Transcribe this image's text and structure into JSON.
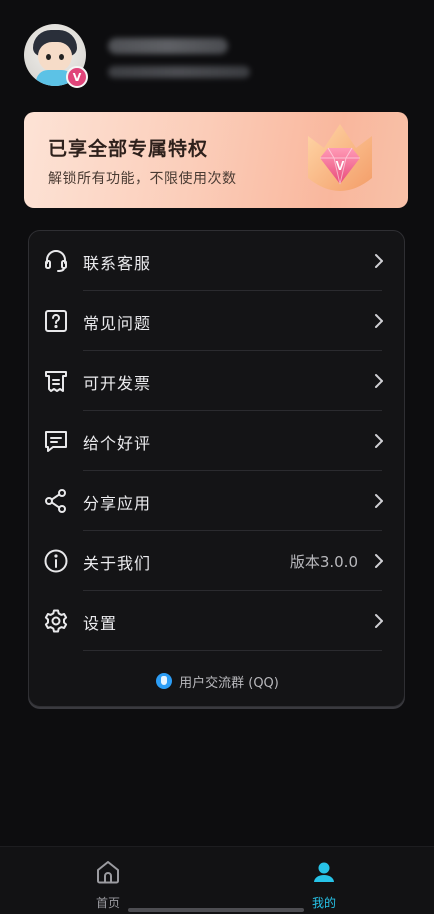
{
  "vip_card": {
    "title": "已享全部专属特权",
    "subtitle": "解锁所有功能，不限使用次数",
    "badge_letter": "V"
  },
  "profile": {
    "badge_letter": "V"
  },
  "menu": {
    "items": [
      {
        "label": "联系客服",
        "icon": "headset-icon"
      },
      {
        "label": "常见问题",
        "icon": "question-icon"
      },
      {
        "label": "可开发票",
        "icon": "invoice-icon"
      },
      {
        "label": "给个好评",
        "icon": "comment-icon"
      },
      {
        "label": "分享应用",
        "icon": "share-icon"
      },
      {
        "label": "关于我们",
        "icon": "info-icon",
        "extra": "版本3.0.0"
      },
      {
        "label": "设置",
        "icon": "gear-icon"
      }
    ],
    "qq_group": "用户交流群 (QQ)"
  },
  "tabbar": {
    "tabs": [
      {
        "label": "首页",
        "icon": "home-icon",
        "active": false
      },
      {
        "label": "我的",
        "icon": "user-icon",
        "active": true
      }
    ]
  },
  "colors": {
    "accent": "#27c3e8",
    "background": "#0d0d0f",
    "vip_pink": "#e0457a"
  }
}
